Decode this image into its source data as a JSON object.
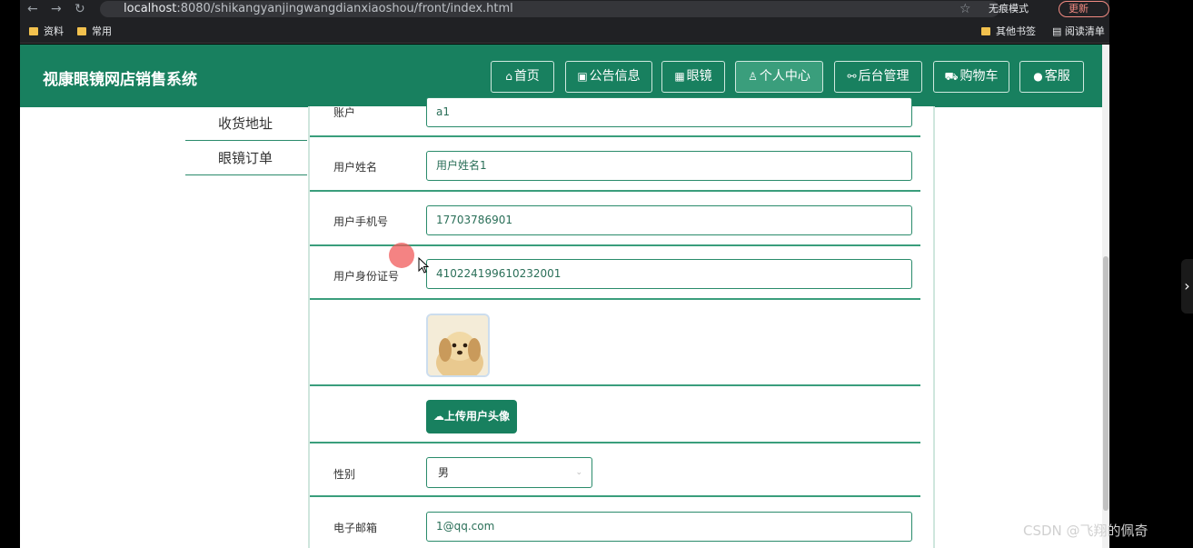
{
  "browser": {
    "url_host": "localhost",
    "url_rest": ":8080/shikangyanjingwangdianxiaoshou/front/index.html",
    "bookmarks": [
      "资料",
      "常用"
    ],
    "other_bookmarks": "其他书签",
    "reading_list": "阅读清单",
    "incognito": "无痕模式",
    "update": "更新"
  },
  "header": {
    "site_title": "视康眼镜网店销售系统",
    "nav": [
      {
        "label": "首页",
        "icon": "home-icon",
        "glyph": "⌂"
      },
      {
        "label": "公告信息",
        "icon": "gift-icon",
        "glyph": "▣"
      },
      {
        "label": "眼镜",
        "icon": "grid-icon",
        "glyph": "▦"
      },
      {
        "label": "个人中心",
        "icon": "user-icon",
        "glyph": "♙"
      },
      {
        "label": "后台管理",
        "icon": "link-icon",
        "glyph": "⚯"
      },
      {
        "label": "购物车",
        "icon": "cart-icon",
        "glyph": "⛟"
      },
      {
        "label": "客服",
        "icon": "chat-icon",
        "glyph": "●"
      }
    ]
  },
  "sidebar": {
    "items": [
      "收货地址",
      "眼镜订单"
    ]
  },
  "form": {
    "account_label": "账户",
    "account_value": "a1",
    "name_label": "用户姓名",
    "name_value": "用户姓名1",
    "phone_label": "用户手机号",
    "phone_value": "17703786901",
    "id_label": "用户身份证号",
    "id_value": "410224199610232001",
    "upload_label": "上传用户头像",
    "gender_label": "性别",
    "gender_value": "男",
    "email_label": "电子邮箱",
    "email_value": "1@qq.com"
  },
  "watermark": "CSDN @飞翔的佩奇",
  "colors": {
    "primary": "#18805f",
    "active": "#3a9e7c"
  }
}
